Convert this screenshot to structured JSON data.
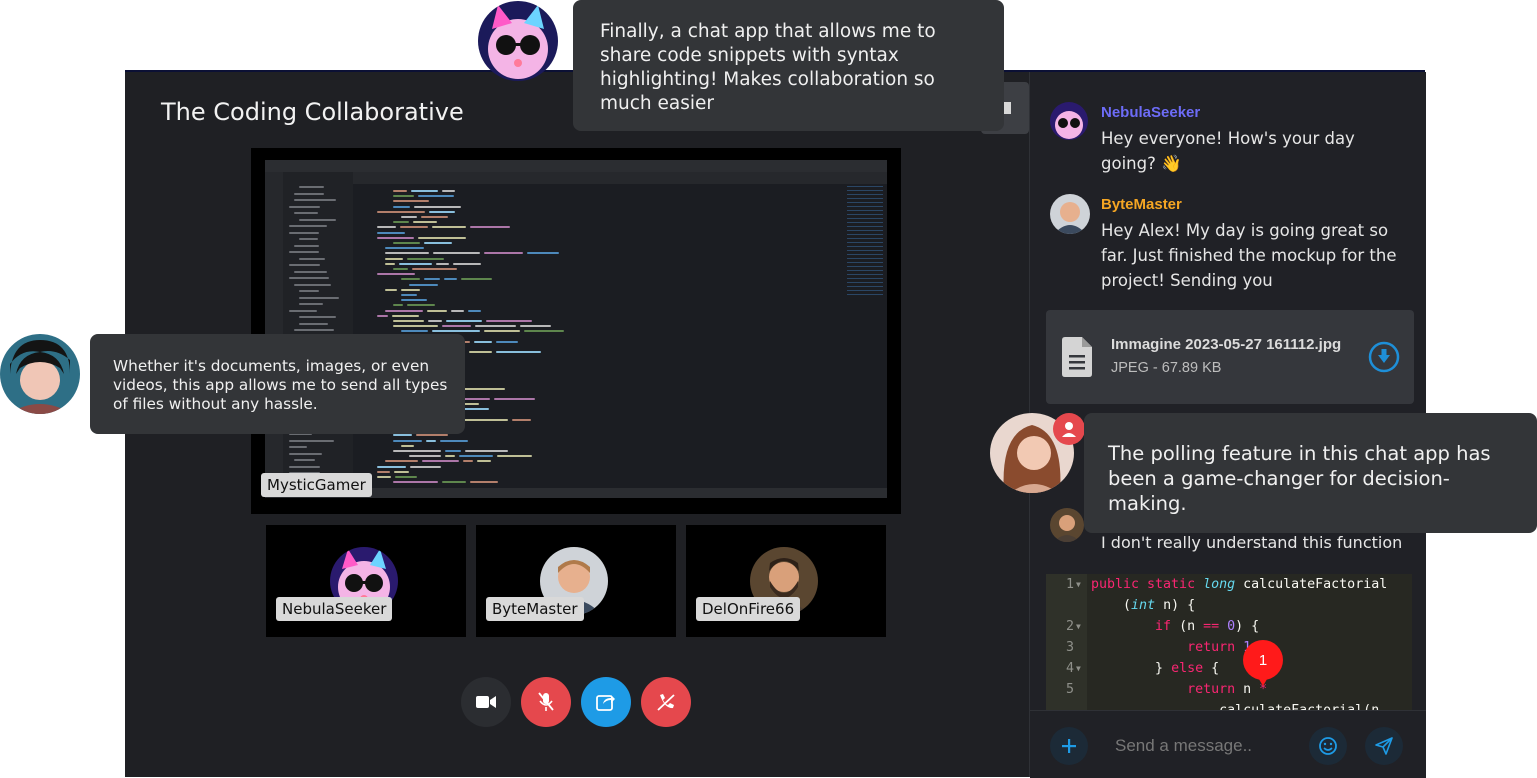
{
  "room_title": "The Coding Collaborative",
  "main_video": {
    "presenter": "MysticGamer"
  },
  "participants": [
    {
      "name": "NebulaSeeker"
    },
    {
      "name": "ByteMaster"
    },
    {
      "name": "DelOnFire66"
    }
  ],
  "controls": [
    {
      "id": "camera",
      "icon": "video-camera-icon",
      "color": "#2b2d31"
    },
    {
      "id": "mic",
      "icon": "microphone-off-icon",
      "color": "#e5484d"
    },
    {
      "id": "share",
      "icon": "share-screen-icon",
      "color": "#1e9be6"
    },
    {
      "id": "hangup",
      "icon": "phone-off-icon",
      "color": "#e5484d"
    }
  ],
  "chat": {
    "messages": [
      {
        "user": "NebulaSeeker",
        "color": "#6d6cf7",
        "text": "Hey everyone! How's your day going? 👋"
      },
      {
        "user": "ByteMaster",
        "color": "#f5a623",
        "text": "Hey Alex! My day is going great so far. Just finished the mockup for the project! Sending you"
      }
    ],
    "file": {
      "name": "Immagine 2023-05-27 161112.jpg",
      "meta": "JPEG - 67.89 KB"
    },
    "last_message_text": "I don't really understand this function",
    "code_lines": [
      {
        "n": "1",
        "fold": true
      },
      {
        "n": "",
        "fold": false
      },
      {
        "n": "2",
        "fold": true
      },
      {
        "n": "3",
        "fold": false
      },
      {
        "n": "4",
        "fold": true
      },
      {
        "n": "5",
        "fold": false
      },
      {
        "n": "",
        "fold": false
      }
    ],
    "unread_count": "1",
    "input_placeholder": "Send a message.."
  },
  "testimonials": {
    "top": "Finally, a chat app that allows me to share code snippets with syntax highlighting! Makes collaboration so much easier",
    "left": "Whether it's documents, images, or even videos, this app allows me to send all types of files without any hassle.",
    "right": "The polling feature in this chat app has been a game-changer for decision-making."
  }
}
